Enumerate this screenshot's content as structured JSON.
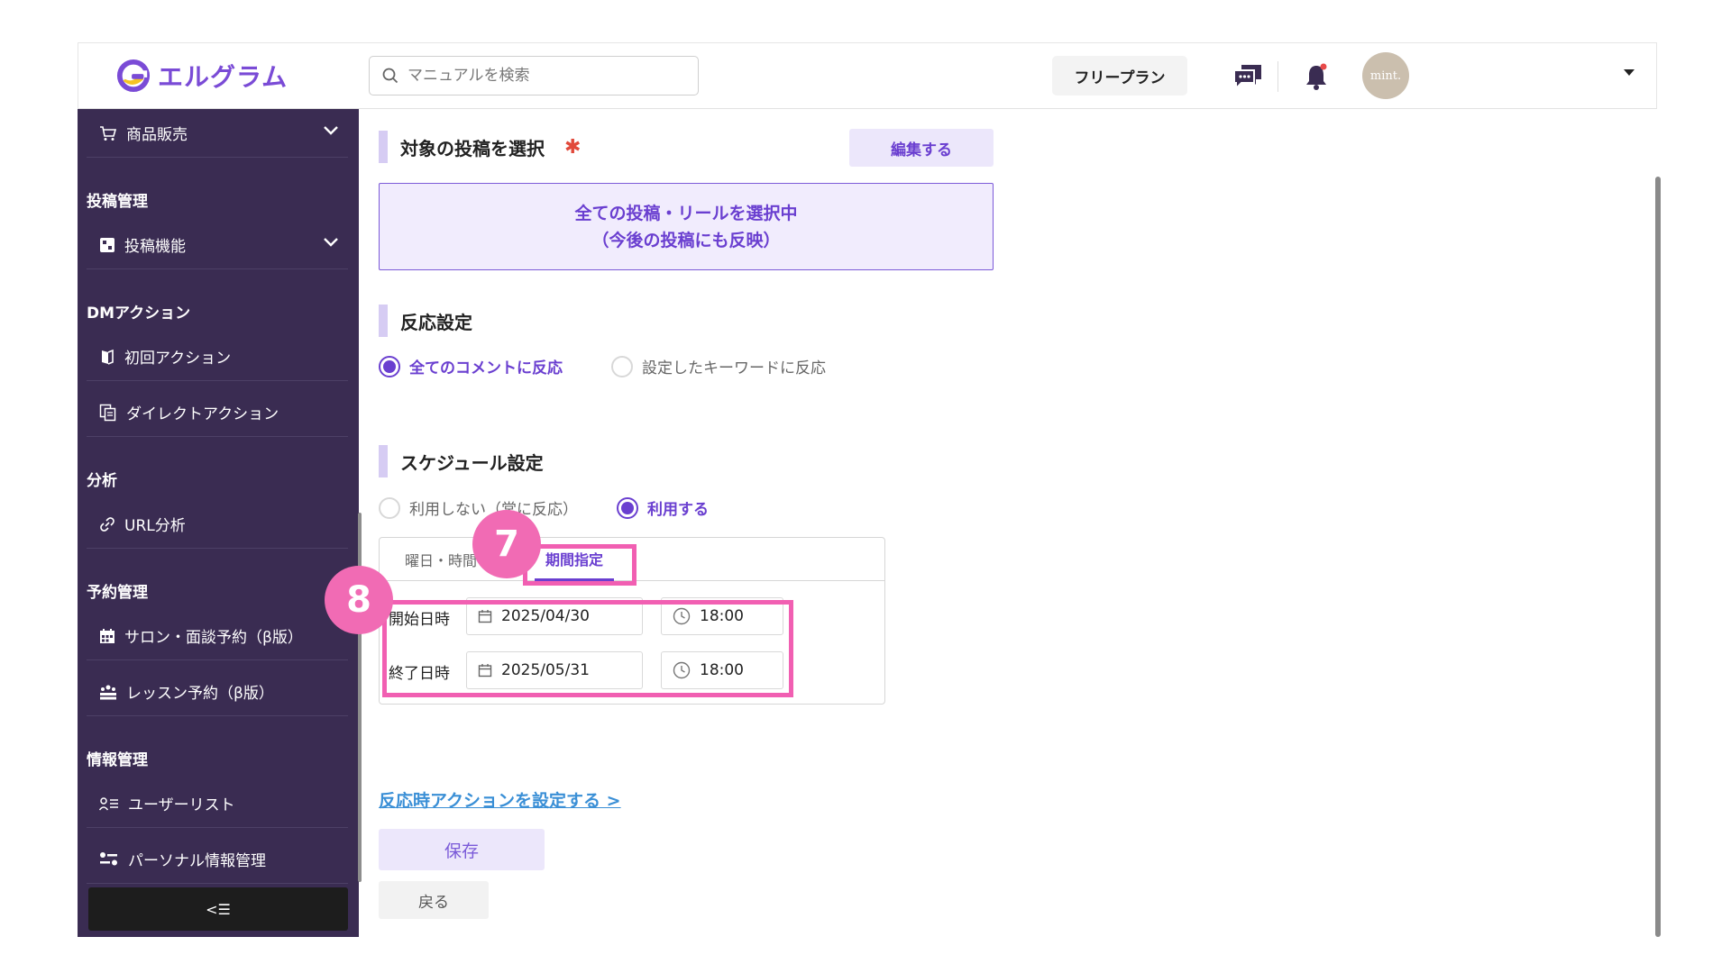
{
  "header": {
    "logo_text": "エルグラム",
    "search_placeholder": "マニュアルを検索",
    "plan_label": "フリープラン",
    "avatar_text": "mint."
  },
  "sidebar": {
    "items": [
      {
        "label": "商品販売"
      },
      {
        "section": "投稿管理"
      },
      {
        "label": "投稿機能"
      },
      {
        "section": "DMアクション"
      },
      {
        "label": "初回アクション"
      },
      {
        "label": "ダイレクトアクション"
      },
      {
        "section": "分析"
      },
      {
        "label": "URL分析"
      },
      {
        "section": "予約管理"
      },
      {
        "label": "サロン・面談予約（β版）"
      },
      {
        "label": "レッスン予約（β版）"
      },
      {
        "section": "情報管理"
      },
      {
        "label": "ユーザーリスト"
      },
      {
        "label": "パーソナル情報管理"
      }
    ],
    "collapse_label": "<☰"
  },
  "main": {
    "target": {
      "title": "対象の投稿を選択",
      "required_mark": "✱",
      "edit_label": "編集する",
      "selection_line1": "全ての投稿・リールを選択中",
      "selection_line2": "（今後の投稿にも反映）"
    },
    "reaction": {
      "title": "反応設定",
      "option_all": "全てのコメントに反応",
      "option_keyword": "設定したキーワードに反応"
    },
    "schedule": {
      "title": "スケジュール設定",
      "option_off": "利用しない（常に反応）",
      "option_on": "利用する",
      "tab_weekday": "曜日・時間",
      "tab_period": "期間指定",
      "start_label": "開始日時",
      "start_date": "2025/04/30",
      "start_time": "18:00",
      "end_label": "終了日時",
      "end_date": "2025/05/31",
      "end_time": "18:00"
    },
    "action_link": "反応時アクションを設定する >",
    "save_label": "保存",
    "back_label": "戻る"
  },
  "annotations": {
    "badge_7": "7",
    "badge_8": "8",
    "color": "#f15fb2"
  },
  "colors": {
    "accent": "#6a3fd0",
    "sidebar_bg": "#3a2c52",
    "highlight_box": "#f1ecfd"
  }
}
